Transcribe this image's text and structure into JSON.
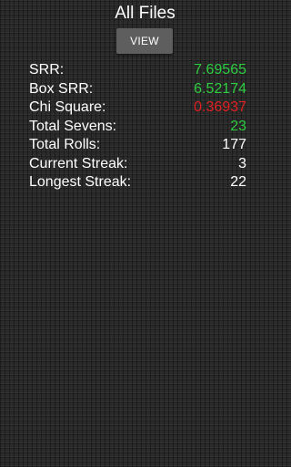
{
  "header": {
    "title": "All Files",
    "view_label": "VIEW"
  },
  "stats": [
    {
      "label": "SRR:",
      "value": "7.69565",
      "color": "#2ecc40"
    },
    {
      "label": "Box SRR:",
      "value": "6.52174",
      "color": "#2ecc40"
    },
    {
      "label": "Chi Square:",
      "value": "0.36937",
      "color": "#e02020"
    },
    {
      "label": "Total Sevens:",
      "value": "23",
      "color": "#2ecc40"
    },
    {
      "label": "Total Rolls:",
      "value": "177",
      "color": "#ffffff"
    },
    {
      "label": "Current Streak:",
      "value": "3",
      "color": "#ffffff"
    },
    {
      "label": "Longest Streak:",
      "value": "22",
      "color": "#ffffff"
    }
  ]
}
